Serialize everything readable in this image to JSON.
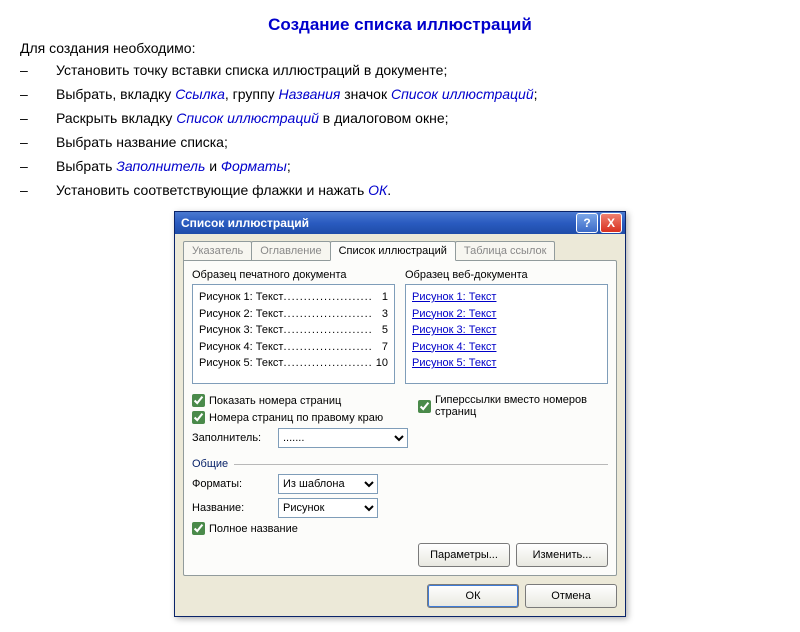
{
  "page": {
    "title": "Создание списка иллюстраций",
    "intro": "Для создания необходимо:",
    "bullets": [
      [
        {
          "t": "Установить точку вставки списка иллюстраций в документе;"
        }
      ],
      [
        {
          "t": "Выбрать, вкладку "
        },
        {
          "k": "Ссылка"
        },
        {
          "t": ", группу "
        },
        {
          "k": "Названия"
        },
        {
          "t": " значок "
        },
        {
          "k": "Список иллюстраций"
        },
        {
          "t": ";"
        }
      ],
      [
        {
          "t": "Раскрыть вкладку "
        },
        {
          "k": "Список иллюстраций"
        },
        {
          "t": " в диалоговом окне;"
        }
      ],
      [
        {
          "t": "Выбрать название списка;"
        }
      ],
      [
        {
          "t": "Выбрать "
        },
        {
          "k": "Заполнитель"
        },
        {
          "t": " и "
        },
        {
          "k": "Форматы"
        },
        {
          "t": ";"
        }
      ],
      [
        {
          "t": "Установить соответствующие флажки и нажать "
        },
        {
          "k": "ОК"
        },
        {
          "t": "."
        }
      ]
    ]
  },
  "dialog": {
    "title": "Список иллюстраций",
    "help_icon": "?",
    "close_icon": "X",
    "tabs": [
      "Указатель",
      "Оглавление",
      "Список иллюстраций",
      "Таблица ссылок"
    ],
    "active_tab": 2,
    "print_preview_label": "Образец печатного документа",
    "web_preview_label": "Образец веб-документа",
    "print_items": [
      {
        "label": "Рисунок 1: Текст",
        "page": "1"
      },
      {
        "label": "Рисунок 2: Текст",
        "page": "3"
      },
      {
        "label": "Рисунок 3: Текст",
        "page": "5"
      },
      {
        "label": "Рисунок 4: Текст",
        "page": "7"
      },
      {
        "label": "Рисунок 5: Текст",
        "page": "10"
      }
    ],
    "web_items": [
      "Рисунок 1: Текст",
      "Рисунок 2: Текст",
      "Рисунок 3: Текст",
      "Рисунок 4: Текст",
      "Рисунок 5: Текст"
    ],
    "cb_show_pages": "Показать номера страниц",
    "cb_right_align": "Номера страниц по правому краю",
    "cb_hyperlinks": "Гиперссылки вместо номеров страниц",
    "leader_label": "Заполнитель:",
    "leader_value": ".......",
    "group_general": "Общие",
    "formats_label": "Форматы:",
    "formats_value": "Из шаблона",
    "caption_label": "Название:",
    "caption_value": "Рисунок",
    "cb_full_caption": "Полное название",
    "btn_options": "Параметры...",
    "btn_modify": "Изменить...",
    "btn_ok": "ОК",
    "btn_cancel": "Отмена"
  }
}
